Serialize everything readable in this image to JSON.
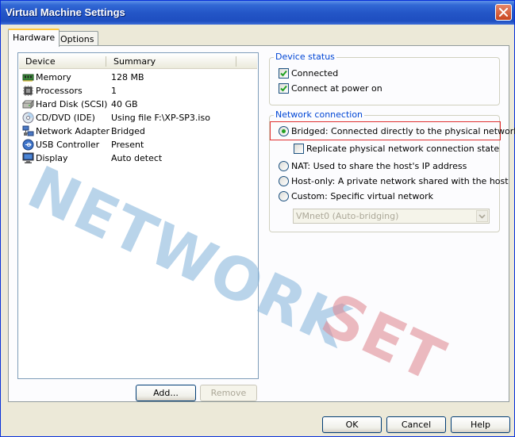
{
  "window": {
    "title": "Virtual Machine Settings"
  },
  "tabs": [
    {
      "label": "Hardware",
      "selected": true
    },
    {
      "label": "Options",
      "selected": false
    }
  ],
  "device_list": {
    "columns": [
      "Device",
      "Summary"
    ],
    "rows": [
      {
        "device": "Memory",
        "summary": "128 MB",
        "icon": "memory-icon"
      },
      {
        "device": "Processors",
        "summary": "1",
        "icon": "processor-icon"
      },
      {
        "device": "Hard Disk (SCSI)",
        "summary": "40 GB",
        "icon": "hard-disk-icon"
      },
      {
        "device": "CD/DVD (IDE)",
        "summary": "Using file F:\\XP-SP3.iso",
        "icon": "cd-dvd-icon"
      },
      {
        "device": "Network Adapter",
        "summary": "Bridged",
        "icon": "network-adapter-icon"
      },
      {
        "device": "USB Controller",
        "summary": "Present",
        "icon": "usb-icon"
      },
      {
        "device": "Display",
        "summary": "Auto detect",
        "icon": "display-icon"
      }
    ]
  },
  "buttons": {
    "add": "Add...",
    "remove": "Remove",
    "ok": "OK",
    "cancel": "Cancel",
    "help": "Help"
  },
  "device_status": {
    "legend": "Device status",
    "connected": {
      "label": "Connected",
      "checked": true
    },
    "connect_at_power_on": {
      "label": "Connect at power on",
      "checked": true
    }
  },
  "network_connection": {
    "legend": "Network connection",
    "bridged": {
      "label": "Bridged: Connected directly to the physical network",
      "selected": true
    },
    "replicate": {
      "label": "Replicate physical network connection state",
      "checked": false
    },
    "nat": {
      "label": "NAT: Used to share the host's IP address",
      "selected": false
    },
    "host_only": {
      "label": "Host-only: A private network shared with the host",
      "selected": false
    },
    "custom": {
      "label": "Custom: Specific virtual network",
      "selected": false
    },
    "custom_select": {
      "value": "VMnet0 (Auto-bridging)"
    }
  },
  "watermark": {
    "part1": "NETWORK",
    "part2": "SET"
  },
  "colors": {
    "title_bar": "#2456C7",
    "group_label": "#0046D5",
    "highlight": "#E03030",
    "watermark_blue": "#7FB0D8",
    "watermark_red": "#E08C95"
  }
}
